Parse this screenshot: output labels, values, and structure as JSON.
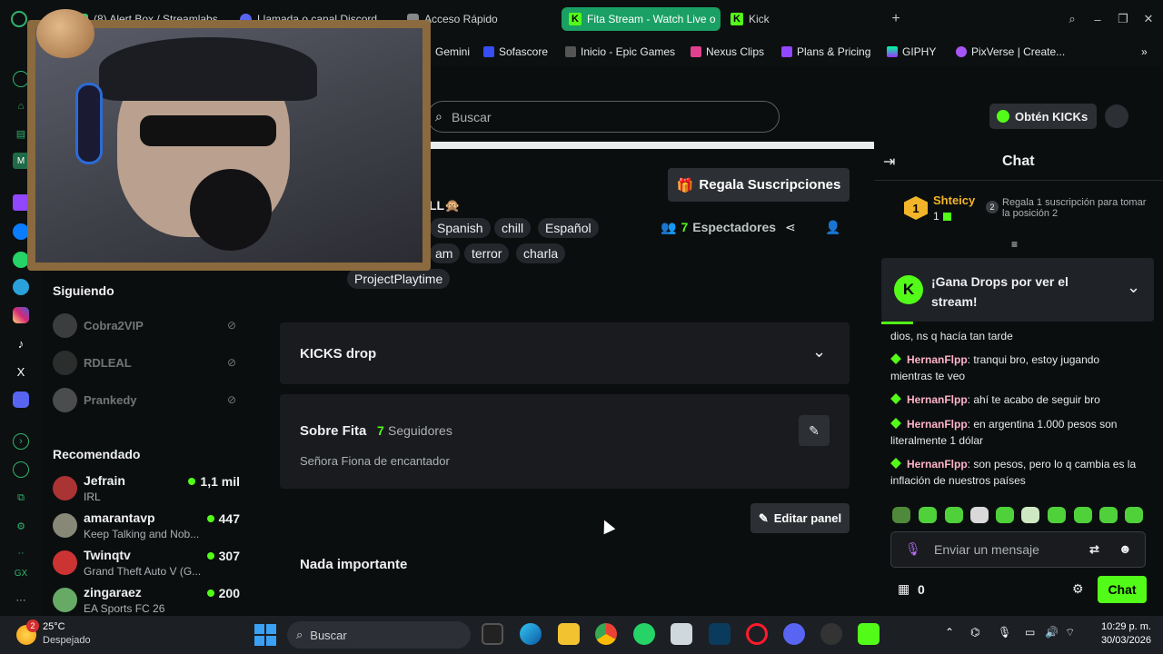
{
  "tabs": [
    {
      "label": "(8) Alert Box / Streamlabs"
    },
    {
      "label": "Llamada o canal Discord"
    },
    {
      "label": "Acceso Rápido"
    },
    {
      "label": "Fita Stream - Watch Live o"
    },
    {
      "label": "Kick"
    }
  ],
  "bookmarks": [
    {
      "label": "Gemini"
    },
    {
      "label": "Sofascore"
    },
    {
      "label": "Inicio - Epic Games"
    },
    {
      "label": "Nexus Clips"
    },
    {
      "label": "Plans & Pricing"
    },
    {
      "label": "GIPHY"
    },
    {
      "label": "PixVerse | Create..."
    }
  ],
  "browser": {
    "ai_label": "AI"
  },
  "header": {
    "search_placeholder": "Buscar",
    "get_kicks": "Obtén KICKs"
  },
  "stream": {
    "title_fragment": "LL🙊",
    "tags_row1": [
      "Spanish",
      "chill",
      "Español"
    ],
    "tags_row2": [
      "am",
      "terror",
      "charla"
    ],
    "category": "ProjectPlaytime",
    "gift_button": "Regala Suscripciones",
    "viewers_count": "7",
    "viewers_label": "Espectadores"
  },
  "panels": {
    "kicks_drop": "KICKS drop",
    "about_title": "Sobre Fita",
    "followers_count": "7",
    "followers_label": "Seguidores",
    "bio": "Señora Fiona de encantador",
    "edit_panel": "Editar panel",
    "nada": "Nada importante"
  },
  "sidebar": {
    "following_heading": "Siguiendo",
    "following": [
      {
        "name": "Cobra2VIP"
      },
      {
        "name": "RDLEAL"
      },
      {
        "name": "Prankedy"
      }
    ],
    "recommended_heading": "Recomendado",
    "recommended": [
      {
        "name": "Jefrain",
        "category": "IRL",
        "viewers": "1,1 mil"
      },
      {
        "name": "amarantavp",
        "category": "Keep Talking and Nob...",
        "viewers": "447"
      },
      {
        "name": "Twinqtv",
        "category": "Grand Theft Auto V (G...",
        "viewers": "307"
      },
      {
        "name": "zingaraez",
        "category": "EA Sports FC 26",
        "viewers": "200"
      }
    ]
  },
  "chat": {
    "title": "Chat",
    "top_rank": "1",
    "top_user": "Shteicy",
    "top_count": "1",
    "gift_rank": "2",
    "gift_hint": "Regala 1 suscripción para tomar la posición 2",
    "drops_banner": "¡Gana Drops por ver el stream!",
    "messages": [
      {
        "user": "",
        "text": "dios, ns q hacía tan tarde"
      },
      {
        "user": "HernanFlpp",
        "text": "tranqui bro, estoy jugando mientras te veo"
      },
      {
        "user": "HernanFlpp",
        "text": "ahí te acabo de seguir bro"
      },
      {
        "user": "HernanFlpp",
        "text": "en argentina 1.000 pesos son literalmente 1 dólar"
      },
      {
        "user": "HernanFlpp",
        "text": "son pesos, pero lo q cambia es la inflación de nuestros países"
      }
    ],
    "input_placeholder": "Enviar un mensaje",
    "points": "0",
    "send_button": "Chat"
  },
  "taskbar": {
    "weather_temp": "25°C",
    "weather_desc": "Despejado",
    "weather_badge": "2",
    "search_placeholder": "Buscar",
    "time": "10:29 p. m.",
    "date": "30/03/2026"
  },
  "colors": {
    "kick_green": "#53fc18",
    "chat_username": "#ffb3c9",
    "tab_active": "#1aa064"
  }
}
